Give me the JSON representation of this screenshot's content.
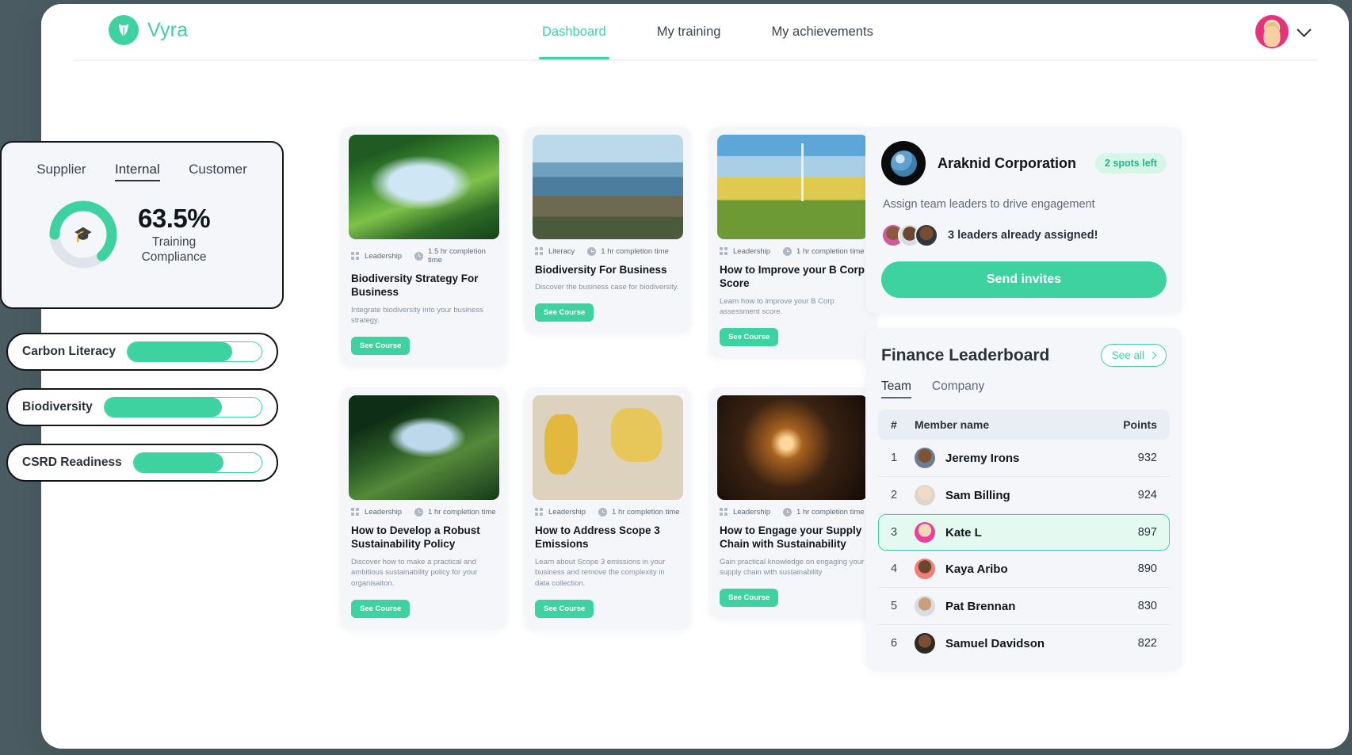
{
  "brand": {
    "name": "Vyra",
    "logo_icon": "leaf-icon",
    "accent": "#3ed2a0"
  },
  "nav": {
    "items": [
      {
        "label": "Dashboard",
        "active": true
      },
      {
        "label": "My training",
        "active": false
      },
      {
        "label": "My achievements",
        "active": false
      }
    ],
    "profile_icon": "avatar",
    "chevron_icon": "chevron-down-icon"
  },
  "compliance": {
    "tabs": [
      {
        "label": "Supplier",
        "active": false
      },
      {
        "label": "Internal",
        "active": true
      },
      {
        "label": "Customer",
        "active": false
      }
    ],
    "percent_label": "63.5%",
    "percent_value": 63.5,
    "caption_line1": "Training",
    "caption_line2": "Compliance",
    "center_icon": "graduation-cap-icon",
    "ring_color": "#3ed2a0",
    "ring_track_color": "#dfe4ec"
  },
  "topic_pills": [
    {
      "label": "Carbon Literacy",
      "fill_percent": 78
    },
    {
      "label": "Biodiversity",
      "fill_percent": 75
    },
    {
      "label": "CSRD Readiness",
      "fill_percent": 70
    }
  ],
  "courses": [
    {
      "image": "forest-canopy",
      "category": "Leadership",
      "duration": "1.5 hr completion time",
      "title": "Biodiversity Strategy For Business",
      "description": "Integrate biodiversity into your business strategy.",
      "cta": "See Course"
    },
    {
      "image": "coastal-cliffs",
      "category": "Literacy",
      "duration": "1 hr completion time",
      "title": "Biodiversity For Business",
      "description": "Discover the business case for biodiversity.",
      "cta": "See Course"
    },
    {
      "image": "wind-turbine-sunflowers",
      "category": "Leadership",
      "duration": "1 hr completion time",
      "title": "How to Improve your B Corp Score",
      "description": "Learn how to improve your B Corp assessment score.",
      "cta": "See Course"
    },
    {
      "image": "tall-trees",
      "category": "Leadership",
      "duration": "1 hr completion time",
      "title": "How to Develop a Robust Sustainability Policy",
      "description": "Discover how to make a practical and ambitious sustainability policy for your organisaiton.",
      "cta": "See Course"
    },
    {
      "image": "world-map",
      "category": "Leadership",
      "duration": "1 hr completion time",
      "title": "How to Address Scope 3 Emissions",
      "description": "Learn about Scope 3 emissions in your business and remove the complexity in data collection.",
      "cta": "See Course"
    },
    {
      "image": "chain-link",
      "category": "Leadership",
      "duration": "1 hr completion time",
      "title": "How to Engage your Supply Chain with Sustainability",
      "description": "Gain practical knowledge on engaging your supply chain with sustainability",
      "cta": "See Course"
    }
  ],
  "team": {
    "icon": "globe-icon",
    "name": "Araknid Corporation",
    "badge": "2 spots left",
    "subtitle": "Assign team leaders to drive engagement",
    "leaders_text": "3 leaders already assigned!",
    "leader_count": 3,
    "cta": "Send invites"
  },
  "leaderboard": {
    "title": "Finance Leaderboard",
    "see_all": "See all",
    "see_all_icon": "chevron-right-icon",
    "tabs": [
      {
        "label": "Team",
        "active": true
      },
      {
        "label": "Company",
        "active": false
      }
    ],
    "columns": {
      "rank": "#",
      "name": "Member name",
      "points": "Points"
    },
    "rows": [
      {
        "rank": "1",
        "name": "Jeremy Irons",
        "points": "932",
        "highlight": false
      },
      {
        "rank": "2",
        "name": "Sam Billing",
        "points": "924",
        "highlight": false
      },
      {
        "rank": "3",
        "name": "Kate L",
        "points": "897",
        "highlight": true
      },
      {
        "rank": "4",
        "name": "Kaya Aribo",
        "points": "890",
        "highlight": false
      },
      {
        "rank": "5",
        "name": "Pat Brennan",
        "points": "830",
        "highlight": false
      },
      {
        "rank": "6",
        "name": "Samuel Davidson",
        "points": "822",
        "highlight": false
      }
    ]
  }
}
